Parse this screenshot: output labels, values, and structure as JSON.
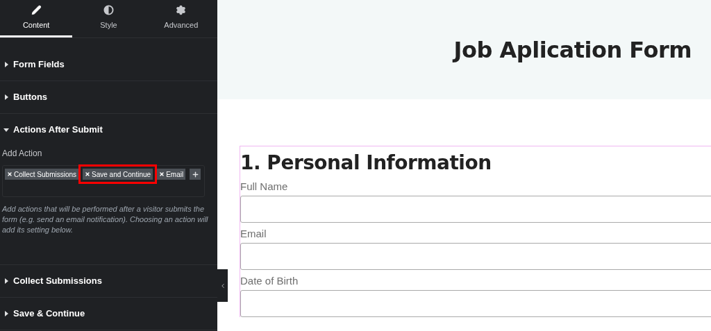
{
  "tabs": [
    {
      "label": "Content",
      "selected": true
    },
    {
      "label": "Style",
      "selected": false
    },
    {
      "label": "Advanced",
      "selected": false
    }
  ],
  "sections": [
    {
      "title": "Form Fields",
      "expanded": false
    },
    {
      "title": "Buttons",
      "expanded": false
    },
    {
      "title": "Actions After Submit",
      "expanded": true,
      "field_label": "Add Action",
      "tags": [
        {
          "label": "Collect Submissions",
          "highlighted": false
        },
        {
          "label": "Save and Continue",
          "highlighted": true
        },
        {
          "label": "Email",
          "highlighted": false
        }
      ],
      "description": "Add actions that will be performed after a visitor submits the form (e.g. send an email notification). Choosing an action will add its setting below."
    },
    {
      "title": "Collect Submissions",
      "expanded": false
    },
    {
      "title": "Save & Continue",
      "expanded": false
    }
  ],
  "page": {
    "title": "Job Aplication Form",
    "section_heading": "1. Personal Information",
    "fields": [
      {
        "label": "Full Name"
      },
      {
        "label": "Email"
      },
      {
        "label": "Date of Birth"
      }
    ]
  }
}
